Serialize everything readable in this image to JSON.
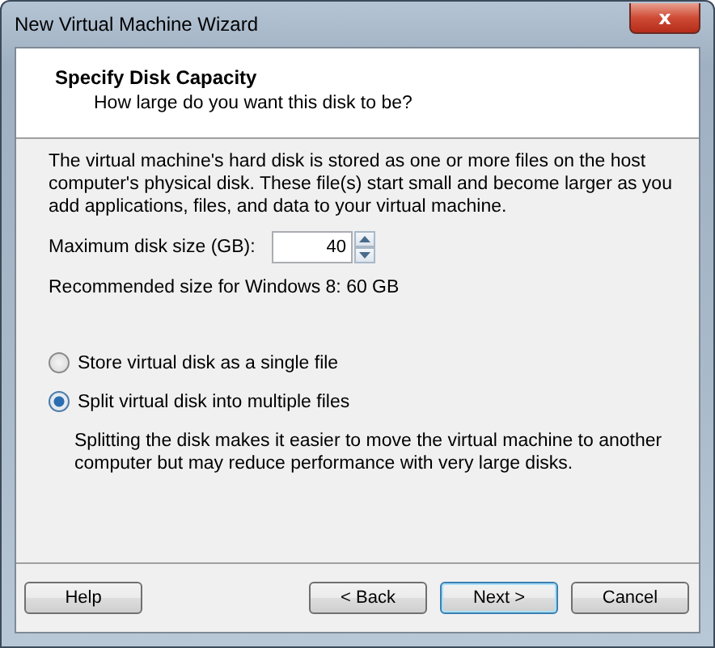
{
  "window": {
    "title": "New Virtual Machine Wizard",
    "close": "x"
  },
  "header": {
    "title": "Specify Disk Capacity",
    "subtitle": "How large do you want this disk to be?"
  },
  "description": "The virtual machine's hard disk is stored as one or more files on the host computer's physical disk. These file(s) start small and become larger as you add applications, files, and data to your virtual machine.",
  "disk_size": {
    "label": "Maximum disk size (GB):",
    "value": "40"
  },
  "recommended": "Recommended size for Windows 8: 60 GB",
  "options": [
    {
      "label": "Store virtual disk as a single file",
      "selected": false
    },
    {
      "label": "Split virtual disk into multiple files",
      "selected": true,
      "note": "Splitting the disk makes it easier to move the virtual machine to another computer but may reduce performance with very large disks."
    }
  ],
  "buttons": [
    {
      "label": "Help",
      "kind": "help",
      "default": false
    },
    {
      "label": "< Back",
      "kind": "nav",
      "default": false
    },
    {
      "label": "Next >",
      "kind": "nav",
      "default": true
    },
    {
      "label": "Cancel",
      "kind": "nav",
      "default": false
    }
  ]
}
